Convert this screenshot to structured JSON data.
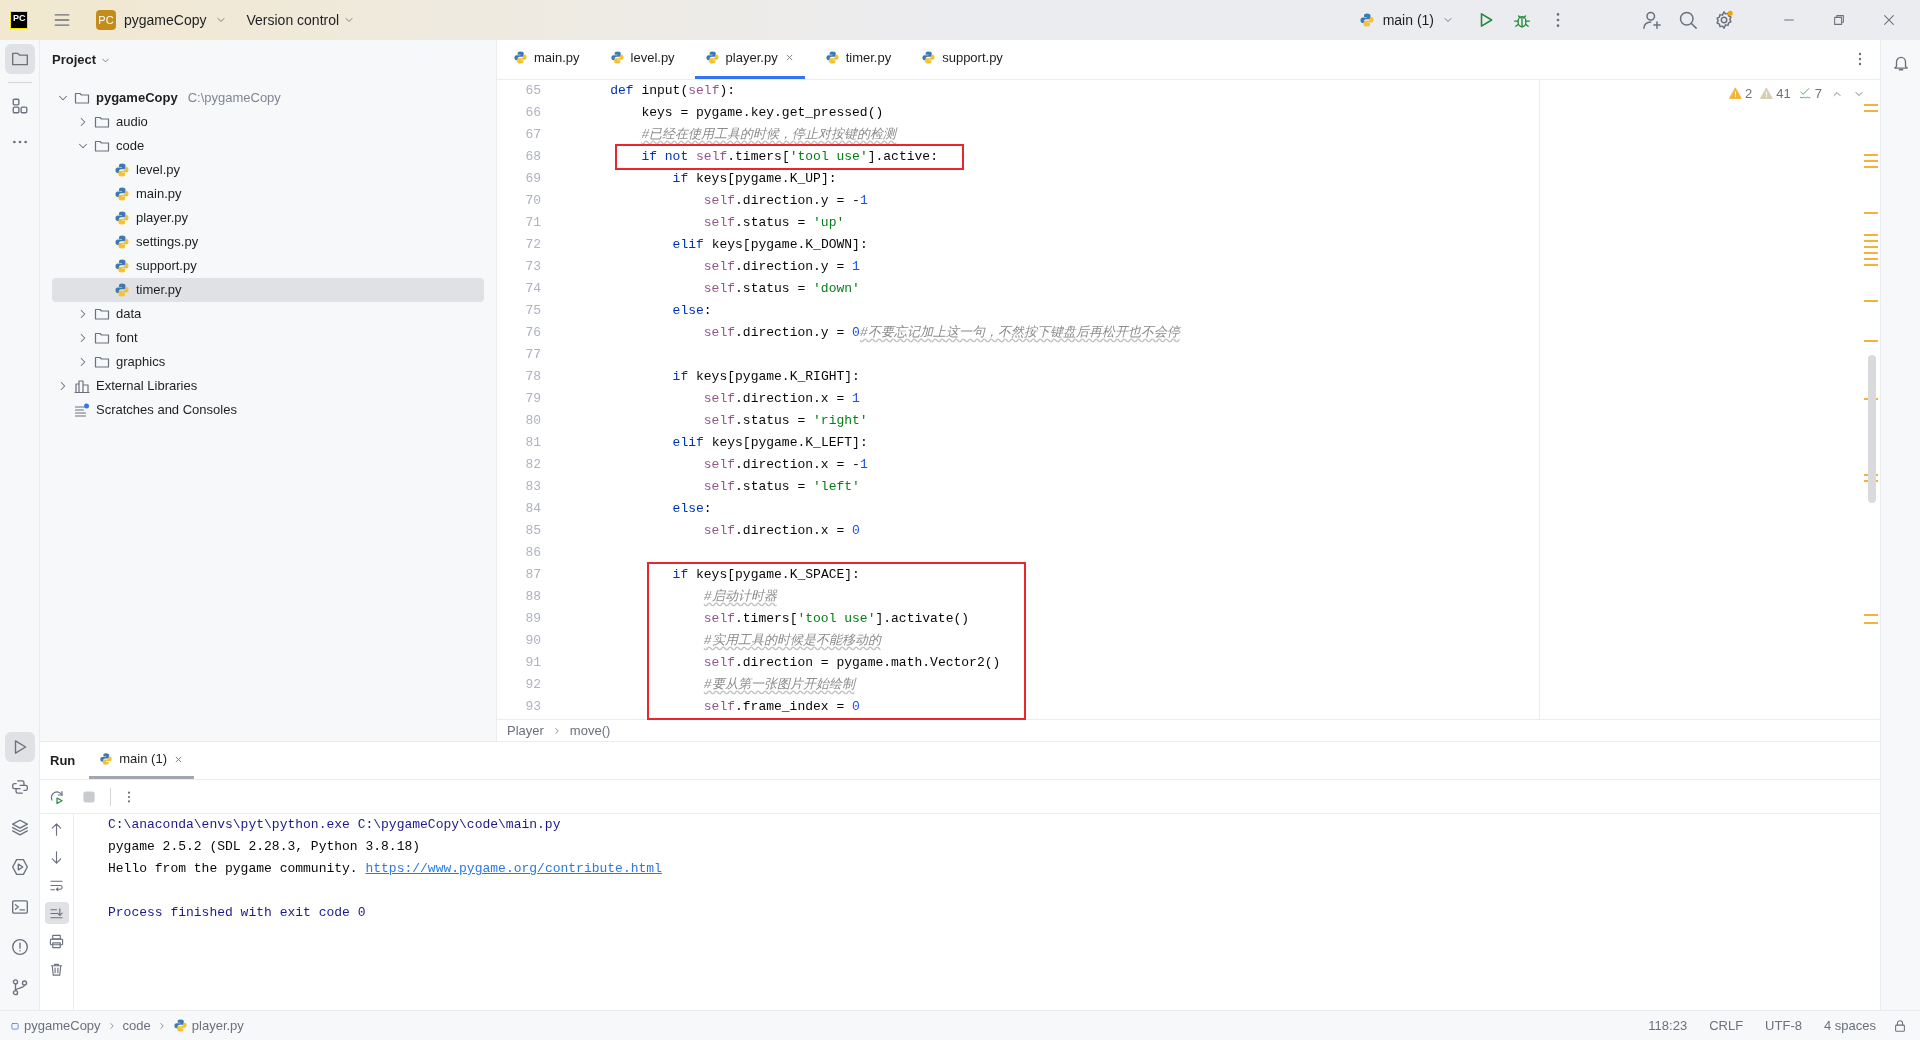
{
  "title_bar": {
    "logo_text": "PC",
    "project_badge": "PC",
    "project": "pygameCopy",
    "vcs": "Version control",
    "run_config": "main (1)"
  },
  "project": {
    "title": "Project",
    "tree": [
      {
        "name": "pygameCopy",
        "path": "C:\\pygameCopy",
        "kind": "folder",
        "expanded": true,
        "selected": false,
        "children": [
          {
            "name": "audio",
            "kind": "folder",
            "expanded": false,
            "selected": false
          },
          {
            "name": "code",
            "kind": "folder",
            "expanded": true,
            "selected": false,
            "children": [
              {
                "name": "level.py",
                "kind": "python",
                "selected": false
              },
              {
                "name": "main.py",
                "kind": "python",
                "selected": false
              },
              {
                "name": "player.py",
                "kind": "python",
                "selected": false
              },
              {
                "name": "settings.py",
                "kind": "python",
                "selected": false
              },
              {
                "name": "support.py",
                "kind": "python",
                "selected": false
              },
              {
                "name": "timer.py",
                "kind": "python",
                "selected": true
              }
            ]
          },
          {
            "name": "data",
            "kind": "folder",
            "expanded": false,
            "selected": false
          },
          {
            "name": "font",
            "kind": "folder",
            "expanded": false,
            "selected": false
          },
          {
            "name": "graphics",
            "kind": "folder",
            "expanded": false,
            "selected": false
          }
        ]
      },
      {
        "name": "External Libraries",
        "kind": "library",
        "expanded": false,
        "selected": false
      },
      {
        "name": "Scratches and Consoles",
        "kind": "scratches",
        "selected": false
      }
    ]
  },
  "editor_tabs": [
    {
      "label": "main.py",
      "selected": false
    },
    {
      "label": "level.py",
      "selected": false
    },
    {
      "label": "player.py",
      "selected": true
    },
    {
      "label": "timer.py",
      "selected": false
    },
    {
      "label": "support.py",
      "selected": false
    }
  ],
  "inspections": [
    {
      "kind": "warning",
      "count": "2"
    },
    {
      "kind": "weak_warning",
      "count": "41"
    },
    {
      "kind": "typo",
      "count": "7"
    }
  ],
  "code_lines": [
    {
      "kind": "line",
      "number": "65",
      "text": "    def input(self):"
    },
    {
      "kind": "line",
      "number": "66",
      "text": "        keys = pygame.key.get_pressed()"
    },
    {
      "kind": "line",
      "number": "67",
      "text": "        #已经在使用工具的时候，停止对按键的检测"
    },
    {
      "kind": "annotation_box",
      "lines": [
        {
          "number": "68",
          "text": "        if not self.timers['tool use'].active:"
        }
      ]
    },
    {
      "kind": "line",
      "number": "69",
      "text": "            if keys[pygame.K_UP]:"
    },
    {
      "kind": "line",
      "number": "70",
      "text": "                self.direction.y = -1"
    },
    {
      "kind": "line",
      "number": "71",
      "text": "                self.status = 'up'"
    },
    {
      "kind": "line",
      "number": "72",
      "text": "            elif keys[pygame.K_DOWN]:"
    },
    {
      "kind": "line",
      "number": "73",
      "text": "                self.direction.y = 1"
    },
    {
      "kind": "line",
      "number": "74",
      "text": "                self.status = 'down'"
    },
    {
      "kind": "line",
      "number": "75",
      "text": "            else:"
    },
    {
      "kind": "line",
      "number": "76",
      "text": "                self.direction.y = 0#不要忘记加上这一句，不然按下键盘后再松开也不会停"
    },
    {
      "kind": "line",
      "number": "77"
    },
    {
      "kind": "line",
      "number": "78",
      "text": "            if keys[pygame.K_RIGHT]:"
    },
    {
      "kind": "line",
      "number": "79",
      "text": "                self.direction.x = 1"
    },
    {
      "kind": "line",
      "number": "80",
      "text": "                self.status = 'right'"
    },
    {
      "kind": "line",
      "number": "81",
      "text": "            elif keys[pygame.K_LEFT]:"
    },
    {
      "kind": "line",
      "number": "82",
      "text": "                self.direction.x = -1"
    },
    {
      "kind": "line",
      "number": "83",
      "text": "                self.status = 'left'"
    },
    {
      "kind": "line",
      "number": "84",
      "text": "            else:"
    },
    {
      "kind": "line",
      "number": "85",
      "text": "                self.direction.x = 0"
    },
    {
      "kind": "line",
      "number": "86"
    },
    {
      "kind": "annotation_box",
      "lines": [
        {
          "number": "87",
          "text": "            if keys[pygame.K_SPACE]:"
        },
        {
          "number": "88",
          "text": "                #启动计时器"
        },
        {
          "number": "89",
          "text": "                self.timers['tool use'].activate()"
        },
        {
          "number": "90",
          "text": "                #实用工具的时候是不能移动的"
        },
        {
          "number": "91",
          "text": "                self.direction = pygame.math.Vector2()"
        },
        {
          "number": "92",
          "text": "                #要从第一张图片开始绘制"
        },
        {
          "number": "93",
          "text": "                self.frame_index = 0"
        }
      ]
    }
  ],
  "editor_breadcrumb": [
    "Player",
    "move()"
  ],
  "run_panel": {
    "title": "Run",
    "tabs": [
      {
        "label": "main (1)",
        "selected": true
      }
    ],
    "console_lines": [
      {
        "kind": "system",
        "text": "C:\\anaconda\\envs\\pyt\\python.exe C:\\pygameCopy\\code\\main.py"
      },
      {
        "kind": "output",
        "text": "pygame 2.5.2 (SDL 2.28.3, Python 3.8.18)"
      },
      {
        "kind": "output",
        "text": "Hello from the pygame community. ",
        "link": "https://www.pygame.org/contribute.html"
      },
      {
        "kind": "blank"
      },
      {
        "kind": "system",
        "text": "Process finished with exit code 0"
      }
    ]
  },
  "status_bar": {
    "breadcrumb": [
      {
        "kind": "project",
        "label": "pygameCopy"
      },
      {
        "kind": "folder",
        "label": "code"
      },
      {
        "kind": "python",
        "label": "player.py"
      }
    ],
    "items": [
      "118:23",
      "CRLF",
      "UTF-8",
      "4 spaces"
    ]
  }
}
